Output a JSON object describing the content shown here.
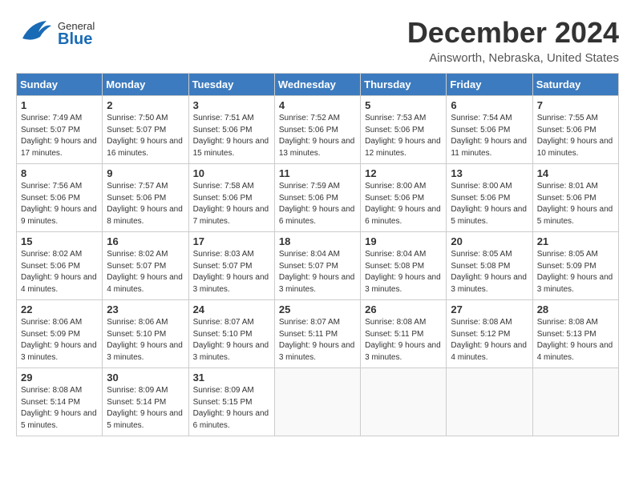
{
  "header": {
    "logo_general": "General",
    "logo_blue": "Blue",
    "month_title": "December 2024",
    "location": "Ainsworth, Nebraska, United States"
  },
  "days_of_week": [
    "Sunday",
    "Monday",
    "Tuesday",
    "Wednesday",
    "Thursday",
    "Friday",
    "Saturday"
  ],
  "weeks": [
    [
      {
        "day": "1",
        "sunrise": "7:49 AM",
        "sunset": "5:07 PM",
        "daylight": "9 hours and 17 minutes."
      },
      {
        "day": "2",
        "sunrise": "7:50 AM",
        "sunset": "5:07 PM",
        "daylight": "9 hours and 16 minutes."
      },
      {
        "day": "3",
        "sunrise": "7:51 AM",
        "sunset": "5:06 PM",
        "daylight": "9 hours and 15 minutes."
      },
      {
        "day": "4",
        "sunrise": "7:52 AM",
        "sunset": "5:06 PM",
        "daylight": "9 hours and 13 minutes."
      },
      {
        "day": "5",
        "sunrise": "7:53 AM",
        "sunset": "5:06 PM",
        "daylight": "9 hours and 12 minutes."
      },
      {
        "day": "6",
        "sunrise": "7:54 AM",
        "sunset": "5:06 PM",
        "daylight": "9 hours and 11 minutes."
      },
      {
        "day": "7",
        "sunrise": "7:55 AM",
        "sunset": "5:06 PM",
        "daylight": "9 hours and 10 minutes."
      }
    ],
    [
      {
        "day": "8",
        "sunrise": "7:56 AM",
        "sunset": "5:06 PM",
        "daylight": "9 hours and 9 minutes."
      },
      {
        "day": "9",
        "sunrise": "7:57 AM",
        "sunset": "5:06 PM",
        "daylight": "9 hours and 8 minutes."
      },
      {
        "day": "10",
        "sunrise": "7:58 AM",
        "sunset": "5:06 PM",
        "daylight": "9 hours and 7 minutes."
      },
      {
        "day": "11",
        "sunrise": "7:59 AM",
        "sunset": "5:06 PM",
        "daylight": "9 hours and 6 minutes."
      },
      {
        "day": "12",
        "sunrise": "8:00 AM",
        "sunset": "5:06 PM",
        "daylight": "9 hours and 6 minutes."
      },
      {
        "day": "13",
        "sunrise": "8:00 AM",
        "sunset": "5:06 PM",
        "daylight": "9 hours and 5 minutes."
      },
      {
        "day": "14",
        "sunrise": "8:01 AM",
        "sunset": "5:06 PM",
        "daylight": "9 hours and 5 minutes."
      }
    ],
    [
      {
        "day": "15",
        "sunrise": "8:02 AM",
        "sunset": "5:06 PM",
        "daylight": "9 hours and 4 minutes."
      },
      {
        "day": "16",
        "sunrise": "8:02 AM",
        "sunset": "5:07 PM",
        "daylight": "9 hours and 4 minutes."
      },
      {
        "day": "17",
        "sunrise": "8:03 AM",
        "sunset": "5:07 PM",
        "daylight": "9 hours and 3 minutes."
      },
      {
        "day": "18",
        "sunrise": "8:04 AM",
        "sunset": "5:07 PM",
        "daylight": "9 hours and 3 minutes."
      },
      {
        "day": "19",
        "sunrise": "8:04 AM",
        "sunset": "5:08 PM",
        "daylight": "9 hours and 3 minutes."
      },
      {
        "day": "20",
        "sunrise": "8:05 AM",
        "sunset": "5:08 PM",
        "daylight": "9 hours and 3 minutes."
      },
      {
        "day": "21",
        "sunrise": "8:05 AM",
        "sunset": "5:09 PM",
        "daylight": "9 hours and 3 minutes."
      }
    ],
    [
      {
        "day": "22",
        "sunrise": "8:06 AM",
        "sunset": "5:09 PM",
        "daylight": "9 hours and 3 minutes."
      },
      {
        "day": "23",
        "sunrise": "8:06 AM",
        "sunset": "5:10 PM",
        "daylight": "9 hours and 3 minutes."
      },
      {
        "day": "24",
        "sunrise": "8:07 AM",
        "sunset": "5:10 PM",
        "daylight": "9 hours and 3 minutes."
      },
      {
        "day": "25",
        "sunrise": "8:07 AM",
        "sunset": "5:11 PM",
        "daylight": "9 hours and 3 minutes."
      },
      {
        "day": "26",
        "sunrise": "8:08 AM",
        "sunset": "5:11 PM",
        "daylight": "9 hours and 3 minutes."
      },
      {
        "day": "27",
        "sunrise": "8:08 AM",
        "sunset": "5:12 PM",
        "daylight": "9 hours and 4 minutes."
      },
      {
        "day": "28",
        "sunrise": "8:08 AM",
        "sunset": "5:13 PM",
        "daylight": "9 hours and 4 minutes."
      }
    ],
    [
      {
        "day": "29",
        "sunrise": "8:08 AM",
        "sunset": "5:14 PM",
        "daylight": "9 hours and 5 minutes."
      },
      {
        "day": "30",
        "sunrise": "8:09 AM",
        "sunset": "5:14 PM",
        "daylight": "9 hours and 5 minutes."
      },
      {
        "day": "31",
        "sunrise": "8:09 AM",
        "sunset": "5:15 PM",
        "daylight": "9 hours and 6 minutes."
      },
      null,
      null,
      null,
      null
    ]
  ]
}
